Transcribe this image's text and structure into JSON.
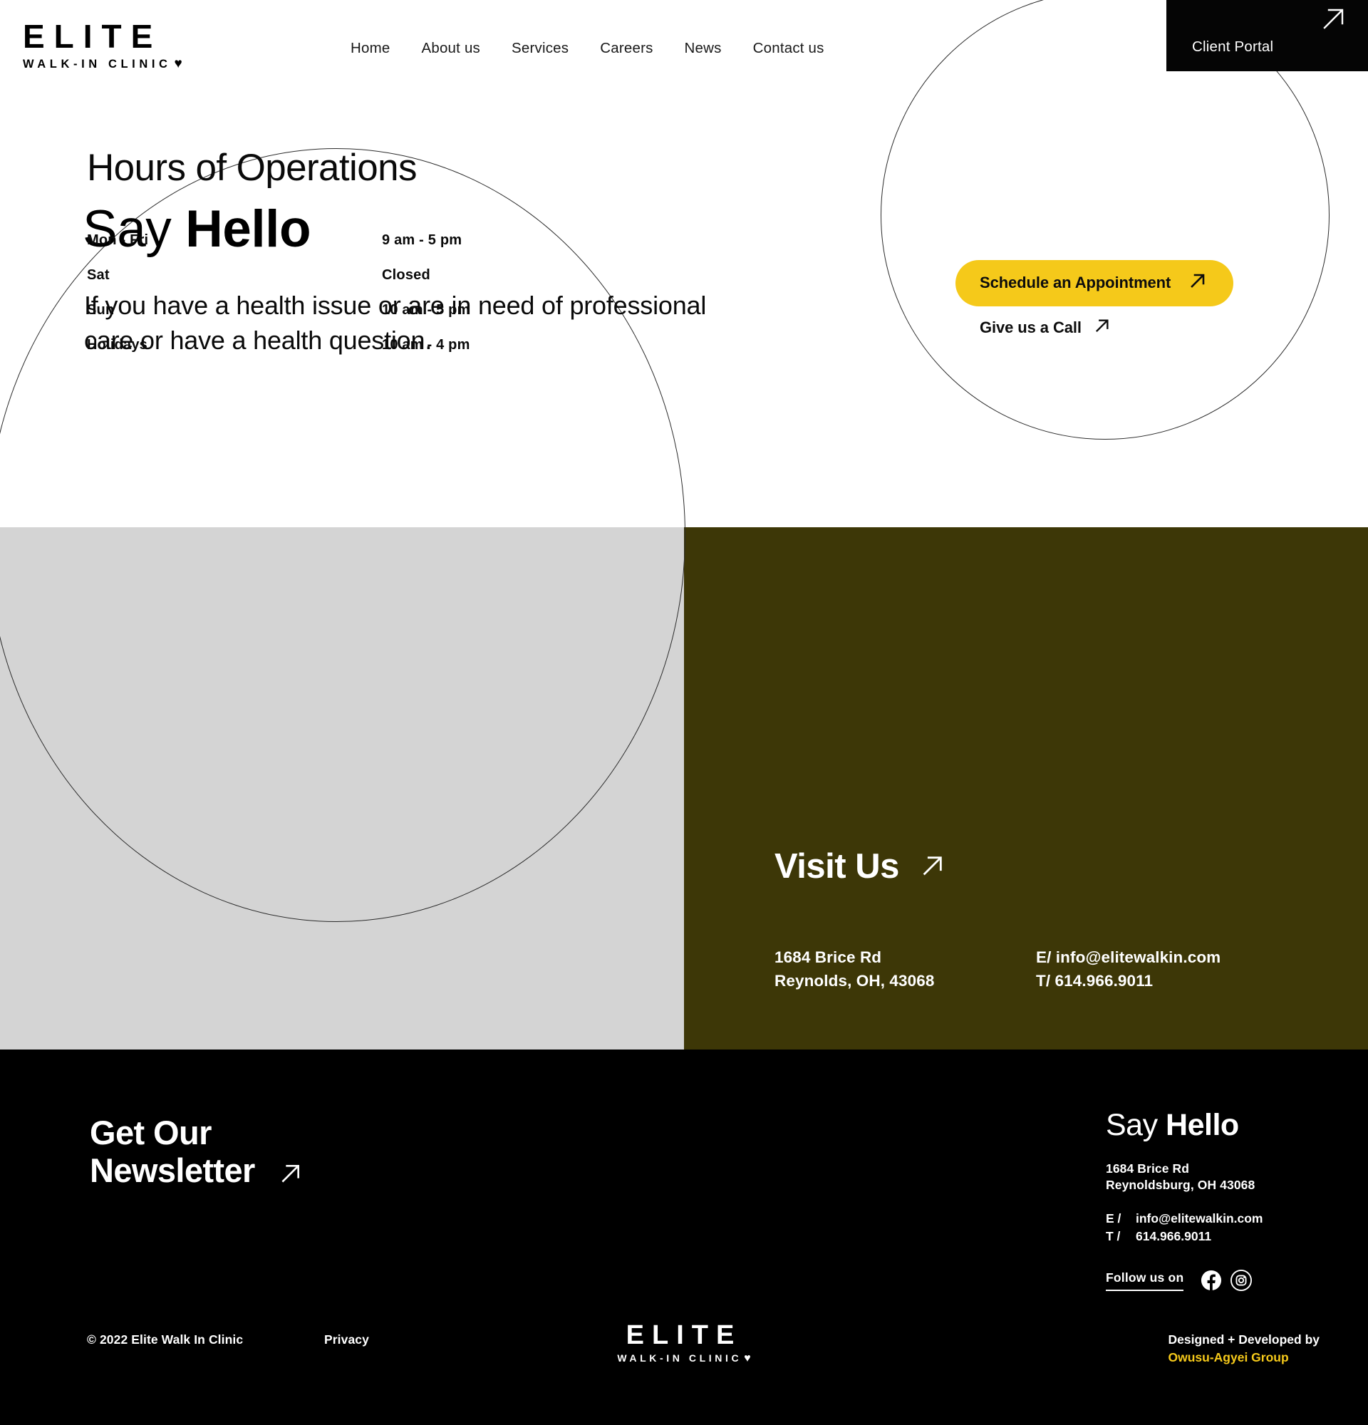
{
  "brand": {
    "logo_main": "ELITE",
    "logo_sub": "WALK-IN CLINIC",
    "heart_icon": "heart-icon",
    "accent_color": "#F5C91A",
    "olive_color": "#3d3707",
    "gray_color": "#d4d4d4"
  },
  "nav": {
    "items": [
      {
        "label": "Home"
      },
      {
        "label": "About us"
      },
      {
        "label": "Services"
      },
      {
        "label": "Careers"
      },
      {
        "label": "News"
      },
      {
        "label": "Contact us"
      }
    ],
    "client_portal": {
      "label": "Client Portal",
      "icon": "arrow-up-right-icon"
    }
  },
  "hero": {
    "title_light": "Say ",
    "title_bold": "Hello",
    "subtitle": "If you have a health issue or are in need of professional care or have a health question.",
    "primary_cta": {
      "label": "Schedule an Appointment",
      "icon": "arrow-up-right-icon"
    },
    "secondary_cta": {
      "label": "Give us a Call",
      "icon": "arrow-up-right-icon"
    }
  },
  "hours": {
    "title": "Hours of Operations",
    "rows": [
      {
        "day": "Mon - Fri",
        "time": "9 am - 5 pm"
      },
      {
        "day": "Sat",
        "time": "Closed"
      },
      {
        "day": "Sun",
        "time": "10 am - 5 pm"
      },
      {
        "day": "Holidays",
        "time": "10 am - 4 pm"
      }
    ]
  },
  "visit": {
    "title": "Visit Us",
    "icon": "arrow-up-right-icon",
    "address_line1": "1684 Brice Rd",
    "address_line2": "Reynolds, OH, 43068",
    "email_line": "E/ info@elitewalkin.com",
    "phone_line": "T/ 614.966.9011"
  },
  "footer": {
    "newsletter": {
      "title_line1": "Get Our",
      "title_line2": "Newsletter",
      "icon": "arrow-up-right-icon"
    },
    "say_hello": {
      "title_light": "Say ",
      "title_bold": "Hello",
      "address_line1": "1684 Brice Rd",
      "address_line2": "Reynoldsburg, OH 43068",
      "email_label": "E /",
      "email_value": "info@elitewalkin.com",
      "phone_label": "T /",
      "phone_value": "614.966.9011",
      "follow_label": "Follow us on",
      "social": [
        {
          "name": "facebook-icon"
        },
        {
          "name": "instagram-icon"
        }
      ]
    },
    "bottom": {
      "copyright": "© 2022 Elite Walk In Clinic",
      "privacy": "Privacy",
      "logo_main": "ELITE",
      "logo_sub": "WALK-IN CLINIC",
      "credit_line": "Designed + Developed by",
      "credit_studio": "Owusu-Agyei Group"
    }
  }
}
